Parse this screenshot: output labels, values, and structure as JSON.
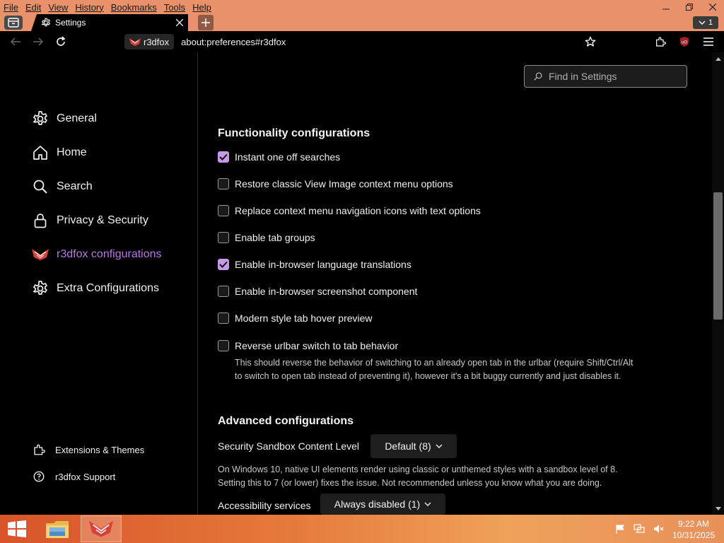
{
  "menubar": {
    "items": [
      "File",
      "Edit",
      "View",
      "History",
      "Bookmarks",
      "Tools",
      "Help"
    ]
  },
  "tabs": {
    "active_title": "Settings",
    "count": "1"
  },
  "urlbar": {
    "identity_label": "r3dfox",
    "url": "about:preferences#r3dfox"
  },
  "search": {
    "placeholder": "Find in Settings"
  },
  "sidebar": {
    "categories": [
      {
        "label": "General",
        "icon": "gear-icon"
      },
      {
        "label": "Home",
        "icon": "home-icon"
      },
      {
        "label": "Search",
        "icon": "search-icon"
      },
      {
        "label": "Privacy & Security",
        "icon": "lock-icon"
      },
      {
        "label": "r3dfox configurations",
        "icon": "r3dfox-logo-icon",
        "selected": true
      },
      {
        "label": "Extra Configurations",
        "icon": "gear-icon"
      }
    ],
    "footer": [
      {
        "label": "Extensions & Themes",
        "icon": "puzzle-icon"
      },
      {
        "label": "r3dfox Support",
        "icon": "help-icon"
      }
    ]
  },
  "functionality": {
    "heading": "Functionality configurations",
    "options": [
      {
        "label": "Instant one off searches",
        "checked": true
      },
      {
        "label": "Restore classic View Image context menu options",
        "checked": false
      },
      {
        "label": "Replace context menu navigation icons with text options",
        "checked": false
      },
      {
        "label": "Enable tab groups",
        "checked": false
      },
      {
        "label": "Enable in-browser language translations",
        "checked": true
      },
      {
        "label": "Enable in-browser screenshot component",
        "checked": false
      },
      {
        "label": "Modern style tab hover preview",
        "checked": false
      },
      {
        "label": "Reverse urlbar switch to tab behavior",
        "checked": false
      }
    ],
    "reverse_desc_line1": "This should reverse the behavior of switching to an already open tab in the urlbar (require Shift/Ctrl/Alt",
    "reverse_desc_line2": "to switch to open tab instead of preventing it), however it's a bit buggy currently and just disables it."
  },
  "advanced": {
    "heading": "Advanced configurations",
    "sandbox_label": "Security Sandbox Content Level",
    "sandbox_value": "Default (8)",
    "sandbox_desc_line1": "On Windows 10, native UI elements render using classic or unthemed styles with a sandbox level of 8.",
    "sandbox_desc_line2": "Setting this to 7 (or lower) fixes the issue. Not recommended unless you know what you are doing.",
    "accessibility_label": "Accessibility services",
    "accessibility_value": "Always disabled (1)"
  },
  "taskbar": {
    "time": "9:22 AM",
    "date": "10/31/2025"
  },
  "colors": {
    "accent": "#b677e6",
    "checkbox_on": "#c59ae6",
    "chrome": "#e8916a",
    "background": "#000000"
  }
}
